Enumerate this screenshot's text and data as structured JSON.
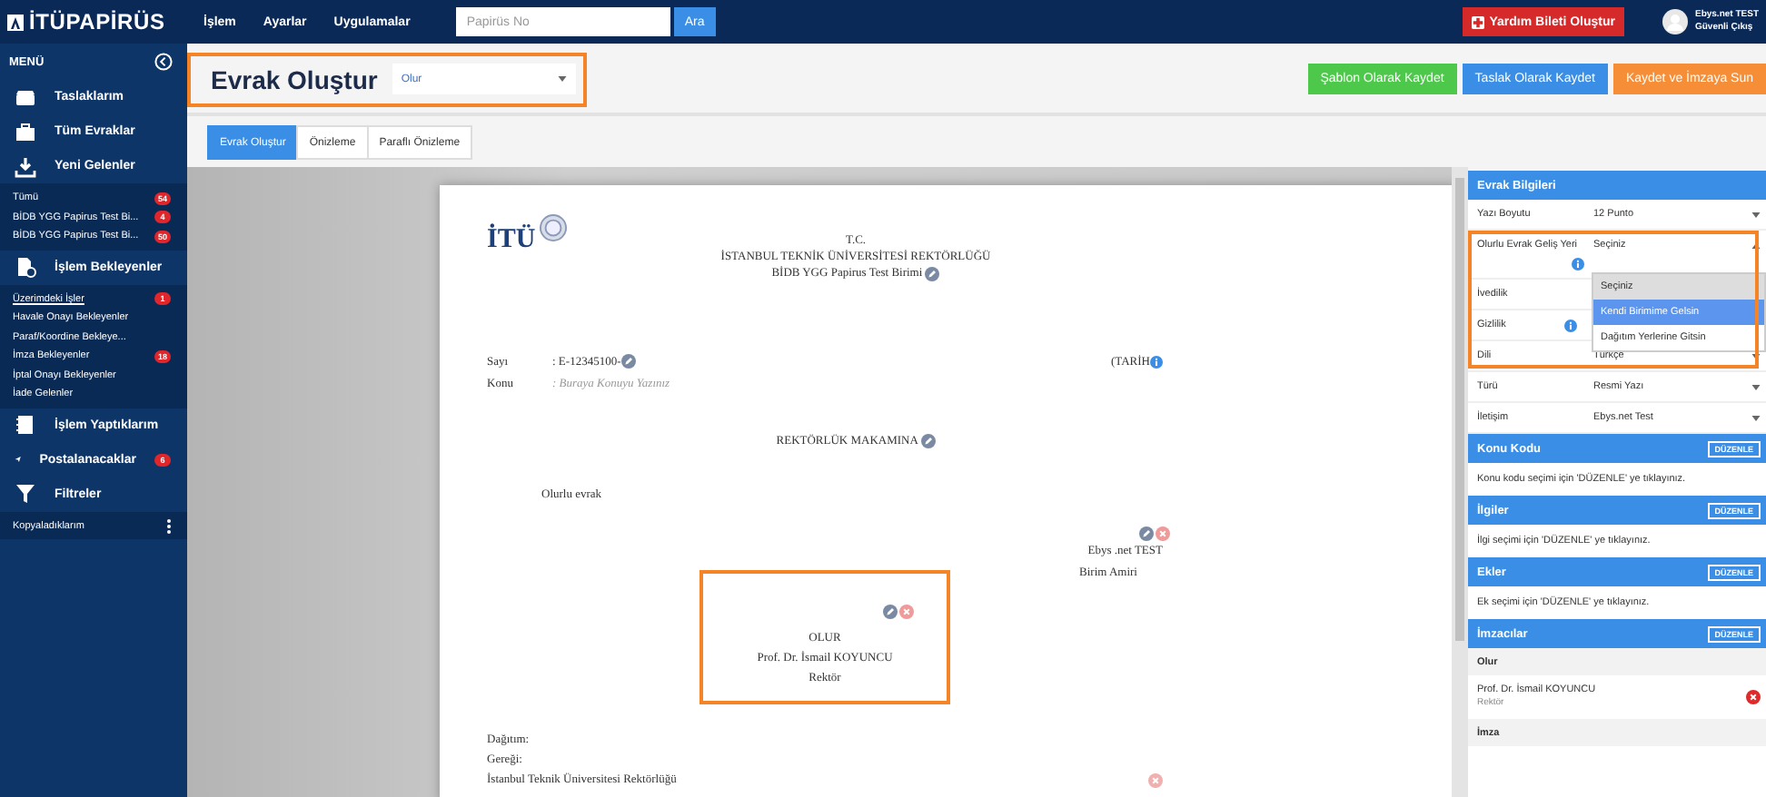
{
  "topbar": {
    "logo": "İTÜPAPİRÜS",
    "menu": [
      "İşlem",
      "Ayarlar",
      "Uygulamalar"
    ],
    "search": {
      "placeholder": "Papirüs No"
    },
    "search_button": "Ara",
    "help_button": "Yardım Bileti Oluştur",
    "user": {
      "name": "Ebys.net TEST",
      "logout": "Güvenli Çıkış"
    }
  },
  "sidebar": {
    "title": "MENÜ",
    "sections": [
      {
        "label": "Taslaklarım"
      },
      {
        "label": "Tüm Evraklar"
      },
      {
        "label": "Yeni Gelenler",
        "children": [
          {
            "label": "Tümü",
            "badge": "54",
            "selected": false
          },
          {
            "label": "BİDB YGG Papirus Test Bi...",
            "badge": "4",
            "selected": false
          },
          {
            "label": "BİDB YGG Papirus Test Bi...",
            "badge": "50",
            "selected": false
          }
        ]
      },
      {
        "label": "İşlem Bekleyenler",
        "children": [
          {
            "label": "Üzerimdeki İşler",
            "badge": "1",
            "selected": true
          },
          {
            "label": "Havale Onayı Bekleyenler",
            "selected": false
          },
          {
            "label": "Paraf/Koordine Bekleye...",
            "selected": false
          },
          {
            "label": "İmza Bekleyenler",
            "badge": "18",
            "selected": false
          },
          {
            "label": "İptal Onayı Bekleyenler",
            "selected": false
          },
          {
            "label": "İade Gelenler",
            "selected": false
          }
        ]
      },
      {
        "label": "İşlem Yaptıklarım"
      },
      {
        "label": "Postalanacaklar",
        "badge": "6"
      },
      {
        "label": "Filtreler",
        "children": [
          {
            "label": "Kopyaladıklarım",
            "selected": false,
            "has_menu": true
          }
        ]
      }
    ]
  },
  "header": {
    "title": "Evrak Oluştur",
    "template": {
      "value": "Olur"
    },
    "highlighted": true,
    "buttons": [
      {
        "label": "Şablon Olarak Kaydet",
        "kind": "success"
      },
      {
        "label": "Taslak Olarak Kaydet",
        "kind": "primary"
      },
      {
        "label": "Kaydet ve İmzaya Sun",
        "kind": "warning"
      }
    ]
  },
  "tabs": [
    {
      "label": "Evrak Oluştur",
      "selected": true
    },
    {
      "label": "Önizleme",
      "selected": false
    },
    {
      "label": "Paraflı Önizleme",
      "selected": false
    }
  ],
  "document": {
    "logo": "İTÜ",
    "heading": [
      "T.C.",
      "İSTANBUL TEKNİK ÜNİVERSİTESİ REKTÖRLÜĞÜ",
      "BİDB YGG Papirus Test Birimi"
    ],
    "number": {
      "label": "Sayı",
      "value": ": E-12345100-"
    },
    "date": "(TARİH",
    "subject": {
      "label": "Konu",
      "placeholder": ": Buraya Konuyu Yazınız"
    },
    "addressee": "REKTÖRLÜK MAKAMINA",
    "body": "Olurlu evrak",
    "signer": {
      "name": "Ebys .net TEST",
      "title": "Birim Amiri"
    },
    "approval": {
      "label": "OLUR",
      "name": "Prof. Dr. İsmail KOYUNCU",
      "title": "Rektör",
      "highlighted": true
    },
    "distribution": {
      "label": "Dağıtım:",
      "action": "Gereği:",
      "recipient": "İstanbul Teknik Üniversitesi Rektörlüğü"
    }
  },
  "panel": {
    "title": "Evrak Bilgileri",
    "fields": [
      {
        "label": "Yazı Boyutu",
        "value": "12 Punto"
      },
      {
        "label": "Olurlu Evrak Geliş Yeri",
        "value": "Seçiniz",
        "info": true,
        "expanded": true,
        "highlighted": true,
        "options": [
          {
            "label": "Seçiniz",
            "selected": true,
            "highlighted": false
          },
          {
            "label": "Kendi Birimime Gelsin",
            "selected": false,
            "highlighted": true
          },
          {
            "label": "Dağıtım Yerlerine Gitsin",
            "selected": false,
            "highlighted": false
          }
        ]
      },
      {
        "label": "İvedilik"
      },
      {
        "label": "Gizlilik",
        "info": true
      },
      {
        "label": "Dili",
        "value": "Türkçe"
      },
      {
        "label": "Türü",
        "value": "Resmi Yazı"
      },
      {
        "label": "İletişim",
        "value": "Ebys.net Test"
      }
    ],
    "sections": [
      {
        "title": "Konu Kodu",
        "button": "DÜZENLE",
        "note": "Konu kodu seçimi için 'DÜZENLE' ye tıklayınız."
      },
      {
        "title": "İlgiler",
        "button": "DÜZENLE",
        "note": "İlgi seçimi için 'DÜZENLE' ye tıklayınız."
      },
      {
        "title": "Ekler",
        "button": "DÜZENLE",
        "note": "Ek seçimi için 'DÜZENLE' ye tıklayınız."
      },
      {
        "title": "İmzacılar",
        "button": "DÜZENLE",
        "groups": [
          {
            "title": "Olur",
            "people": [
              {
                "name": "Prof. Dr. İsmail KOYUNCU",
                "title": "Rektör"
              }
            ]
          },
          {
            "title": "İmza"
          }
        ]
      }
    ]
  }
}
